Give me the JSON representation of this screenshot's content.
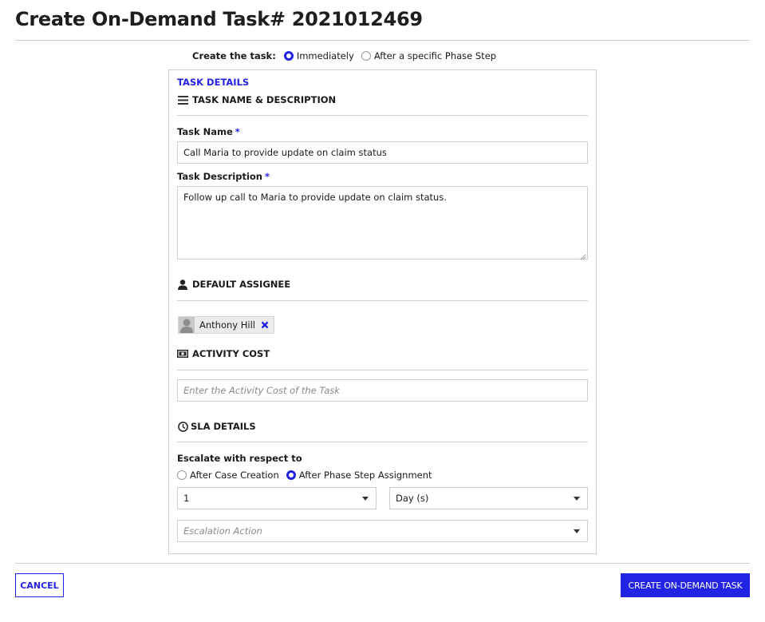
{
  "header": {
    "title": "Create On-Demand Task# 2021012469"
  },
  "create_timing": {
    "label": "Create the task:",
    "options": [
      {
        "label": "Immediately",
        "checked": true
      },
      {
        "label": "After a specific Phase Step",
        "checked": false
      }
    ]
  },
  "task_details": {
    "title": "TASK DETAILS",
    "name_desc_section": {
      "heading": "TASK NAME & DESCRIPTION",
      "icon": "list-icon",
      "task_name_label": "Task Name",
      "task_name_value": "Call Maria to provide update on claim status",
      "task_description_label": "Task Description",
      "task_description_value": "Follow up call to Maria to provide update on claim status.",
      "required_marker": "*"
    },
    "assignee_section": {
      "heading": "DEFAULT ASSIGNEE",
      "icon": "user-icon",
      "assignee": {
        "name": "Anthony Hill",
        "avatar": "user-avatar-icon",
        "remove_icon": "close-icon"
      }
    },
    "activity_cost_section": {
      "heading": "ACTIVITY COST",
      "icon": "money-icon",
      "cost_value": "",
      "cost_placeholder": "Enter the Activity Cost of the Task"
    },
    "sla_section": {
      "heading": "SLA DETAILS",
      "icon": "clock-icon",
      "escalate_label": "Escalate with respect to",
      "escalate_options": [
        {
          "label": "After Case Creation",
          "checked": false
        },
        {
          "label": "After Phase Step Assignment",
          "checked": true
        }
      ],
      "duration_value": "1",
      "duration_unit": "Day (s)",
      "escalation_action_placeholder": "Escalation Action"
    }
  },
  "footer": {
    "cancel_label": "CANCEL",
    "create_label": "CREATE ON-DEMAND TASK"
  },
  "colors": {
    "accent": "#2323e6",
    "border": "#cfcfcf",
    "text": "#1a1a1a"
  }
}
